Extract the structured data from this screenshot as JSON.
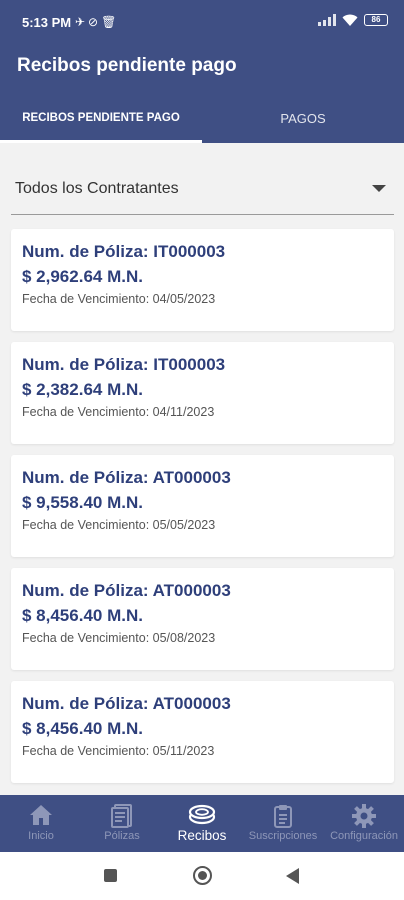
{
  "status_bar": {
    "time": "5:13 PM",
    "battery": "86"
  },
  "app_bar": {
    "title": "Recibos pendiente pago"
  },
  "tabs": [
    {
      "label": "RECIBOS PENDIENTE PAGO",
      "active": true
    },
    {
      "label": "PAGOS",
      "active": false
    }
  ],
  "filter": {
    "selected": "Todos los Contratantes"
  },
  "receipts": [
    {
      "poliza": "Num. de Póliza: IT000003",
      "monto": "$ 2,962.64 M.N.",
      "fecha": "Fecha de Vencimiento: 04/05/2023"
    },
    {
      "poliza": "Num. de Póliza: IT000003",
      "monto": "$ 2,382.64 M.N.",
      "fecha": "Fecha de Vencimiento: 04/11/2023"
    },
    {
      "poliza": "Num. de Póliza: AT000003",
      "monto": "$ 9,558.40 M.N.",
      "fecha": "Fecha de Vencimiento: 05/05/2023"
    },
    {
      "poliza": "Num. de Póliza: AT000003",
      "monto": "$ 8,456.40 M.N.",
      "fecha": "Fecha de Vencimiento: 05/08/2023"
    },
    {
      "poliza": "Num. de Póliza: AT000003",
      "monto": "$ 8,456.40 M.N.",
      "fecha": "Fecha de Vencimiento: 05/11/2023"
    }
  ],
  "bottom_nav": [
    {
      "label": "Inicio",
      "icon": "home-icon",
      "active": false
    },
    {
      "label": "Pólizas",
      "icon": "document-icon",
      "active": false
    },
    {
      "label": "Recibos",
      "icon": "coins-icon",
      "active": true
    },
    {
      "label": "Suscripciones",
      "icon": "clipboard-icon",
      "active": false
    },
    {
      "label": "Configuración",
      "icon": "gear-icon",
      "active": false
    }
  ],
  "colors": {
    "primary": "#3f4f84",
    "text_primary": "#2e3f7a",
    "nav_inactive": "#8e97b8",
    "background": "#f2f2f2"
  }
}
